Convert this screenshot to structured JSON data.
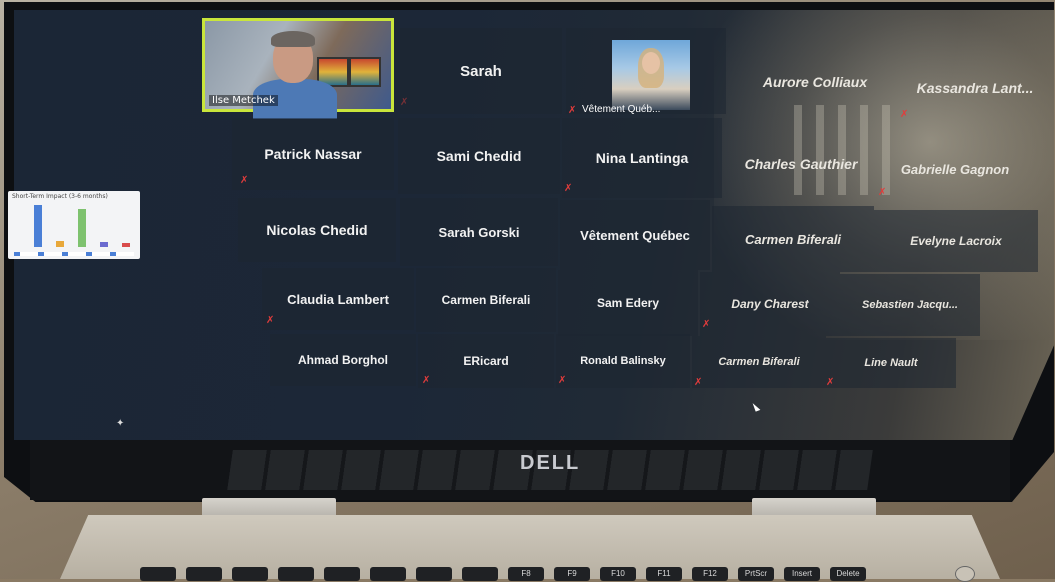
{
  "meeting": {
    "active_speaker": {
      "name": "Ilse Metchek"
    },
    "photo_participant": {
      "label": "Vêtement Québ..."
    },
    "participants": [
      "Sarah",
      "Aurore Colliaux",
      "Kassandra Lant...",
      "Patrick Nassar",
      "Sami Chedid",
      "Nina Lantinga",
      "Charles Gauthier",
      "Gabrielle Gagnon",
      "Nicolas Chedid",
      "Sarah Gorski",
      "Vêtement Québec",
      "Carmen Biferali",
      "Evelyne Lacroix",
      "Claudia Lambert",
      "Carmen Biferali",
      "Sam Edery",
      "Dany Charest",
      "Sebastien Jacqu...",
      "Ahmad Borghol",
      "ERicard",
      "Ronald Balinsky",
      "Carmen Biferali",
      "Line Nault"
    ],
    "mute_icon": "microphone-muted-icon",
    "poll": {
      "title": "Short-Term Impact (3-6 months)"
    }
  },
  "device": {
    "brand": "DELL",
    "function_keys": [
      "",
      "",
      "",
      "",
      "",
      "",
      "",
      "",
      "F8",
      "F9",
      "F10",
      "F11",
      "F12",
      "PrtScr",
      "Insert",
      "Delete"
    ]
  },
  "colors": {
    "active_border": "#c9e53b",
    "mute_red": "#e23c3c",
    "tile_bg": "#1e2632"
  }
}
